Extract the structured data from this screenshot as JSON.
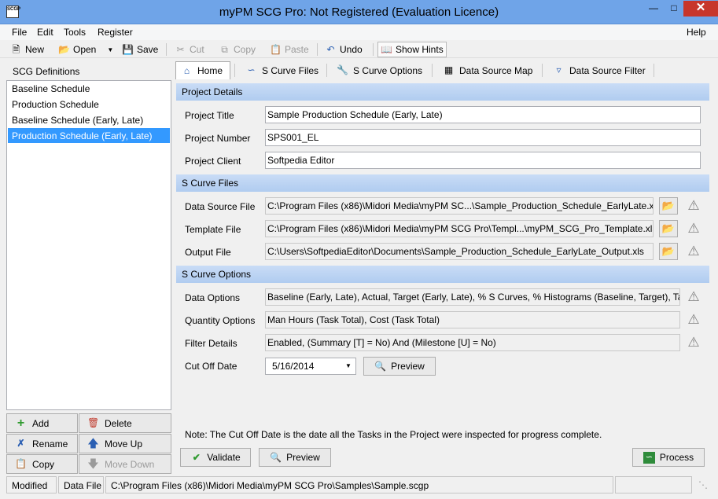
{
  "window": {
    "title": "myPM SCG Pro: Not Registered (Evaluation Licence)",
    "app_icon_text": "SCGP"
  },
  "menu": {
    "items": [
      "File",
      "Edit",
      "Tools",
      "Register"
    ],
    "help": "Help"
  },
  "toolbar": {
    "new": "New",
    "open": "Open",
    "save": "Save",
    "cut": "Cut",
    "copy": "Copy",
    "paste": "Paste",
    "undo": "Undo",
    "show_hints": "Show Hints"
  },
  "left_panel": {
    "header": "SCG Definitions",
    "items": [
      "Baseline Schedule",
      "Production Schedule",
      "Baseline Schedule (Early, Late)",
      "Production Schedule (Early, Late)"
    ],
    "selected_index": 3,
    "buttons": {
      "add": "Add",
      "delete": "Delete",
      "rename": "Rename",
      "move_up": "Move Up",
      "copy": "Copy",
      "move_down": "Move Down"
    }
  },
  "tabs": [
    "Home",
    "S Curve Files",
    "S Curve Options",
    "Data Source Map",
    "Data Source Filter"
  ],
  "project_details": {
    "header": "Project Details",
    "title_label": "Project Title",
    "title_value": "Sample Production Schedule (Early, Late)",
    "number_label": "Project Number",
    "number_value": "SPS001_EL",
    "client_label": "Project Client",
    "client_value": "Softpedia Editor"
  },
  "s_curve_files": {
    "header": "S Curve Files",
    "data_source_label": "Data Source File",
    "data_source_value": "C:\\Program Files (x86)\\Midori Media\\myPM SC...\\Sample_Production_Schedule_EarlyLate.xls",
    "template_label": "Template File",
    "template_value": "C:\\Program Files (x86)\\Midori Media\\myPM SCG Pro\\Templ...\\myPM_SCG_Pro_Template.xls",
    "output_label": "Output File",
    "output_value": "C:\\Users\\SoftpediaEditor\\Documents\\Sample_Production_Schedule_EarlyLate_Output.xls"
  },
  "s_curve_options": {
    "header": "S Curve Options",
    "data_options_label": "Data Options",
    "data_options_value": "Baseline (Early, Late), Actual, Target (Early, Late), % S Curves, % Histograms (Baseline, Target), Tas...",
    "quantity_label": "Quantity Options",
    "quantity_value": "Man Hours (Task Total), Cost (Task Total)",
    "filter_label": "Filter Details",
    "filter_value": "Enabled, (Summary [T] = No) And (Milestone [U] = No)",
    "cutoff_label": "Cut Off Date",
    "cutoff_value": "5/16/2014",
    "preview": "Preview"
  },
  "note": "Note: The Cut Off Date is the date all the Tasks in the Project were inspected for progress complete.",
  "bottom_buttons": {
    "validate": "Validate",
    "preview": "Preview",
    "process": "Process"
  },
  "status": {
    "modified": "Modified",
    "data_file_label": "Data File",
    "data_file_path": "C:\\Program Files (x86)\\Midori Media\\myPM SCG Pro\\Samples\\Sample.scgp"
  }
}
